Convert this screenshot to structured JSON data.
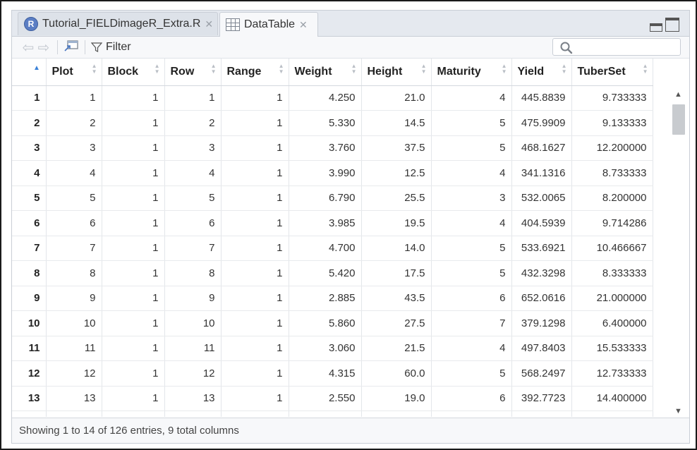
{
  "tabs": [
    {
      "label": "Tutorial_FIELDimageR_Extra.R",
      "icon": "r-script-icon",
      "close": "✕"
    },
    {
      "label": "DataTable",
      "icon": "data-table-icon",
      "close": "✕"
    }
  ],
  "toolbar": {
    "filter_label": "Filter",
    "search_placeholder": ""
  },
  "table": {
    "columns": [
      "",
      "Plot",
      "Block",
      "Row",
      "Range",
      "Weight",
      "Height",
      "Maturity",
      "Yield",
      "TuberSet"
    ],
    "rows": [
      [
        "1",
        "1",
        "1",
        "1",
        "1",
        "4.250",
        "21.0",
        "4",
        "445.8839",
        "9.733333"
      ],
      [
        "2",
        "2",
        "1",
        "2",
        "1",
        "5.330",
        "14.5",
        "5",
        "475.9909",
        "9.133333"
      ],
      [
        "3",
        "3",
        "1",
        "3",
        "1",
        "3.760",
        "37.5",
        "5",
        "468.1627",
        "12.200000"
      ],
      [
        "4",
        "4",
        "1",
        "4",
        "1",
        "3.990",
        "12.5",
        "4",
        "341.1316",
        "8.733333"
      ],
      [
        "5",
        "5",
        "1",
        "5",
        "1",
        "6.790",
        "25.5",
        "3",
        "532.0065",
        "8.200000"
      ],
      [
        "6",
        "6",
        "1",
        "6",
        "1",
        "3.985",
        "19.5",
        "4",
        "404.5939",
        "9.714286"
      ],
      [
        "7",
        "7",
        "1",
        "7",
        "1",
        "4.700",
        "14.0",
        "5",
        "533.6921",
        "10.466667"
      ],
      [
        "8",
        "8",
        "1",
        "8",
        "1",
        "5.420",
        "17.5",
        "5",
        "432.3298",
        "8.333333"
      ],
      [
        "9",
        "9",
        "1",
        "9",
        "1",
        "2.885",
        "43.5",
        "6",
        "652.0616",
        "21.000000"
      ],
      [
        "10",
        "10",
        "1",
        "10",
        "1",
        "5.860",
        "27.5",
        "7",
        "379.1298",
        "6.400000"
      ],
      [
        "11",
        "11",
        "1",
        "11",
        "1",
        "3.060",
        "21.5",
        "4",
        "497.8403",
        "15.533333"
      ],
      [
        "12",
        "12",
        "1",
        "12",
        "1",
        "4.315",
        "60.0",
        "5",
        "568.2497",
        "12.733333"
      ],
      [
        "13",
        "13",
        "1",
        "13",
        "1",
        "2.550",
        "19.0",
        "6",
        "392.7723",
        "14.400000"
      ],
      [
        "",
        "",
        "",
        "",
        "",
        "",
        "",
        "",
        "",
        ""
      ]
    ]
  },
  "status": {
    "text": "Showing 1 to 14 of 126 entries, 9 total columns"
  },
  "colors": {
    "sort_active": "#3b82d8",
    "tabbar_bg": "#e5e9ef",
    "r_logo": "#5b7ec4"
  }
}
